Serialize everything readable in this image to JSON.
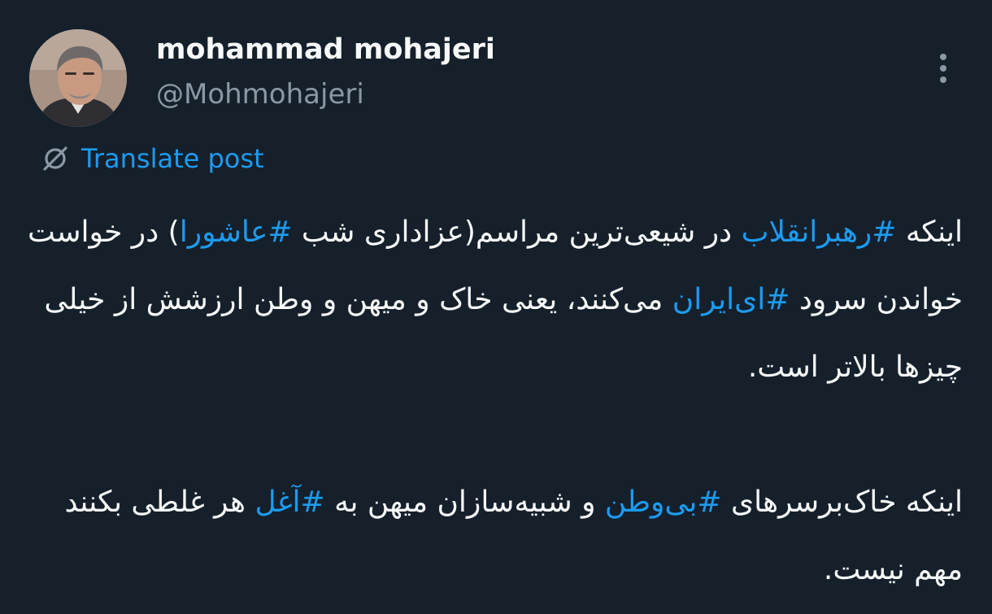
{
  "user": {
    "display_name": "mohammad mohajeri",
    "handle": "@Mohmohajeri"
  },
  "icons": {
    "avatar": "avatar-photo",
    "more": "more-options-icon",
    "translate": "translate-icon"
  },
  "colors": {
    "background": "#15202b",
    "text": "#f7f9f9",
    "secondary_text": "#8b98a5",
    "link": "#1d9bf0"
  },
  "translate": {
    "label": "Translate post"
  },
  "post": {
    "p1": {
      "t1": "اینکه ",
      "h1": "#رهبرانقلاب",
      "t2": " در شیعی‌ترین مراسم(عزاداری شب ",
      "h2": "#عاشورا",
      "t3": ") در خواست خواندن سرود ",
      "h3": "#ای‌ایران",
      "t4": " می‌کنند، یعنی خاک و میهن و وطن ارزشش از خیلی چیزها بالاتر است."
    },
    "p2": {
      "t1": "اینکه خاک‌برسرهای ",
      "h1": "#بی‌وطن",
      "t2": " و شبیه‌سازان میهن به ",
      "h2": "#آغل",
      "t3": " هر غلطی بکنند مهم نیست."
    }
  }
}
